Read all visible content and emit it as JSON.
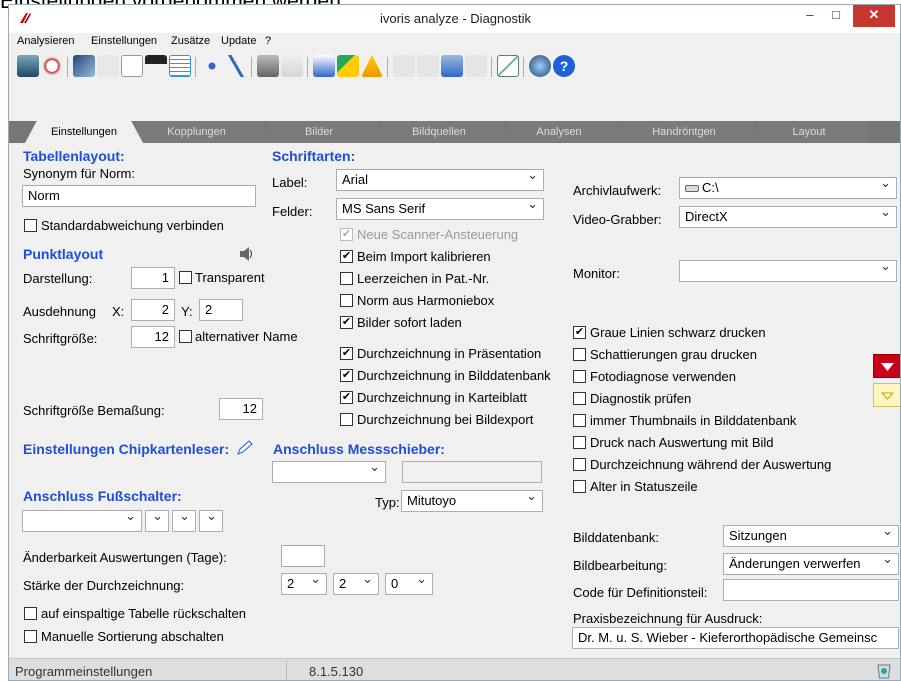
{
  "banner": {
    "text": "Einstellungen vorgenommen werden."
  },
  "window": {
    "title": "ivoris analyze - Diagnostik",
    "min": "–",
    "max": "□",
    "close": "✕"
  },
  "menu": [
    "Analysieren",
    "Einstellungen",
    "Zusätze",
    "Update",
    "?"
  ],
  "tabs": [
    "Einstellungen",
    "Kopplungen",
    "Bilder",
    "Bildquellen",
    "Analysen",
    "Handröntgen",
    "Layout"
  ],
  "left": {
    "tabellenlayout": "Tabellenlayout:",
    "synonym_label": "Synonym für Norm:",
    "synonym_value": "Norm",
    "stdabw": "Standardabweichung verbinden",
    "punktlayout": "Punktlayout",
    "darstellung_label": "Darstellung:",
    "darstellung_value": "1",
    "transparent": "Transparent",
    "ausdehnung_label": "Ausdehnung",
    "x_label": "X:",
    "x_value": "2",
    "y_label": "Y:",
    "y_value": "2",
    "schriftgroesse_label": "Schriftgröße:",
    "schriftgroesse_value": "12",
    "alt_name": "alternativer Name",
    "bemassung_label": "Schriftgröße Bemaßung:",
    "bemassung_value": "12",
    "chipkarte": "Einstellungen Chipkartenleser:",
    "fussschalter": "Anschluss Fußschalter:",
    "aenderbarkeit_label": "Änderbarkeit Auswertungen (Tage):",
    "aenderbarkeit_value": "",
    "staerke_label": "Stärke der Durchzeichnung:",
    "staerke_values": [
      "2",
      "2",
      "0"
    ],
    "einspaltig": "auf einspaltige Tabelle rückschalten",
    "sortierung": "Manuelle Sortierung abschalten"
  },
  "middle": {
    "schriftarten": "Schriftarten:",
    "label_label": "Label:",
    "label_font": "Arial",
    "felder_label": "Felder:",
    "felder_font": "MS Sans Serif",
    "checks": [
      {
        "label": "Neue Scanner-Ansteuerung",
        "checked": true,
        "disabled": true
      },
      {
        "label": "Beim Import kalibrieren",
        "checked": true,
        "disabled": false
      },
      {
        "label": "Leerzeichen in Pat.-Nr.",
        "checked": false,
        "disabled": false
      },
      {
        "label": "Norm aus Harmoniebox",
        "checked": false,
        "disabled": false
      },
      {
        "label": "Bilder sofort laden",
        "checked": true,
        "disabled": false
      },
      {
        "label": "Durchzeichnung in Präsentation",
        "checked": true,
        "disabled": false
      },
      {
        "label": "Durchzeichnung in Bilddatenbank",
        "checked": true,
        "disabled": false
      },
      {
        "label": "Durchzeichnung in Karteiblatt",
        "checked": true,
        "disabled": false
      },
      {
        "label": "Durchzeichnung bei Bildexport",
        "checked": false,
        "disabled": false
      }
    ],
    "messschieber": "Anschluss Messschieber:",
    "typ_label": "Typ:",
    "typ_value": "Mitutoyo"
  },
  "right": {
    "archiv_label": "Archivlaufwerk:",
    "archiv_value": "C:\\",
    "video_label": "Video-Grabber:",
    "video_value": "DirectX",
    "monitor_label": "Monitor:",
    "checks": [
      {
        "label": "Graue Linien schwarz drucken",
        "checked": true
      },
      {
        "label": "Schattierungen grau drucken",
        "checked": false
      },
      {
        "label": "Fotodiagnose verwenden",
        "checked": false
      },
      {
        "label": "Diagnostik prüfen",
        "checked": false
      },
      {
        "label": "immer Thumbnails in Bilddatenbank",
        "checked": false
      },
      {
        "label": "Druck nach Auswertung mit Bild",
        "checked": false
      },
      {
        "label": "Durchzeichnung während der Auswertung",
        "checked": false
      },
      {
        "label": "Alter in Statuszeile",
        "checked": false
      }
    ],
    "bilddb_label": "Bilddatenbank:",
    "bilddb_value": "Sitzungen",
    "bildbearb_label": "Bildbearbeitung:",
    "bildbearb_value": "Änderungen verwerfen",
    "code_label": "Code für Definitionsteil:",
    "code_value": "",
    "praxis_label": "Praxisbezeichnung für Ausdruck:",
    "praxis_value": "Dr. M. u. S. Wieber - Kieferorthopädische Gemeinsc"
  },
  "status": {
    "left": "Programmeinstellungen",
    "version": "8.1.5.130"
  },
  "colors": {
    "accent": "#1f4fd8",
    "close": "#c7372f",
    "tabs": "#7b7b7b",
    "red_button": "#c9001a"
  }
}
